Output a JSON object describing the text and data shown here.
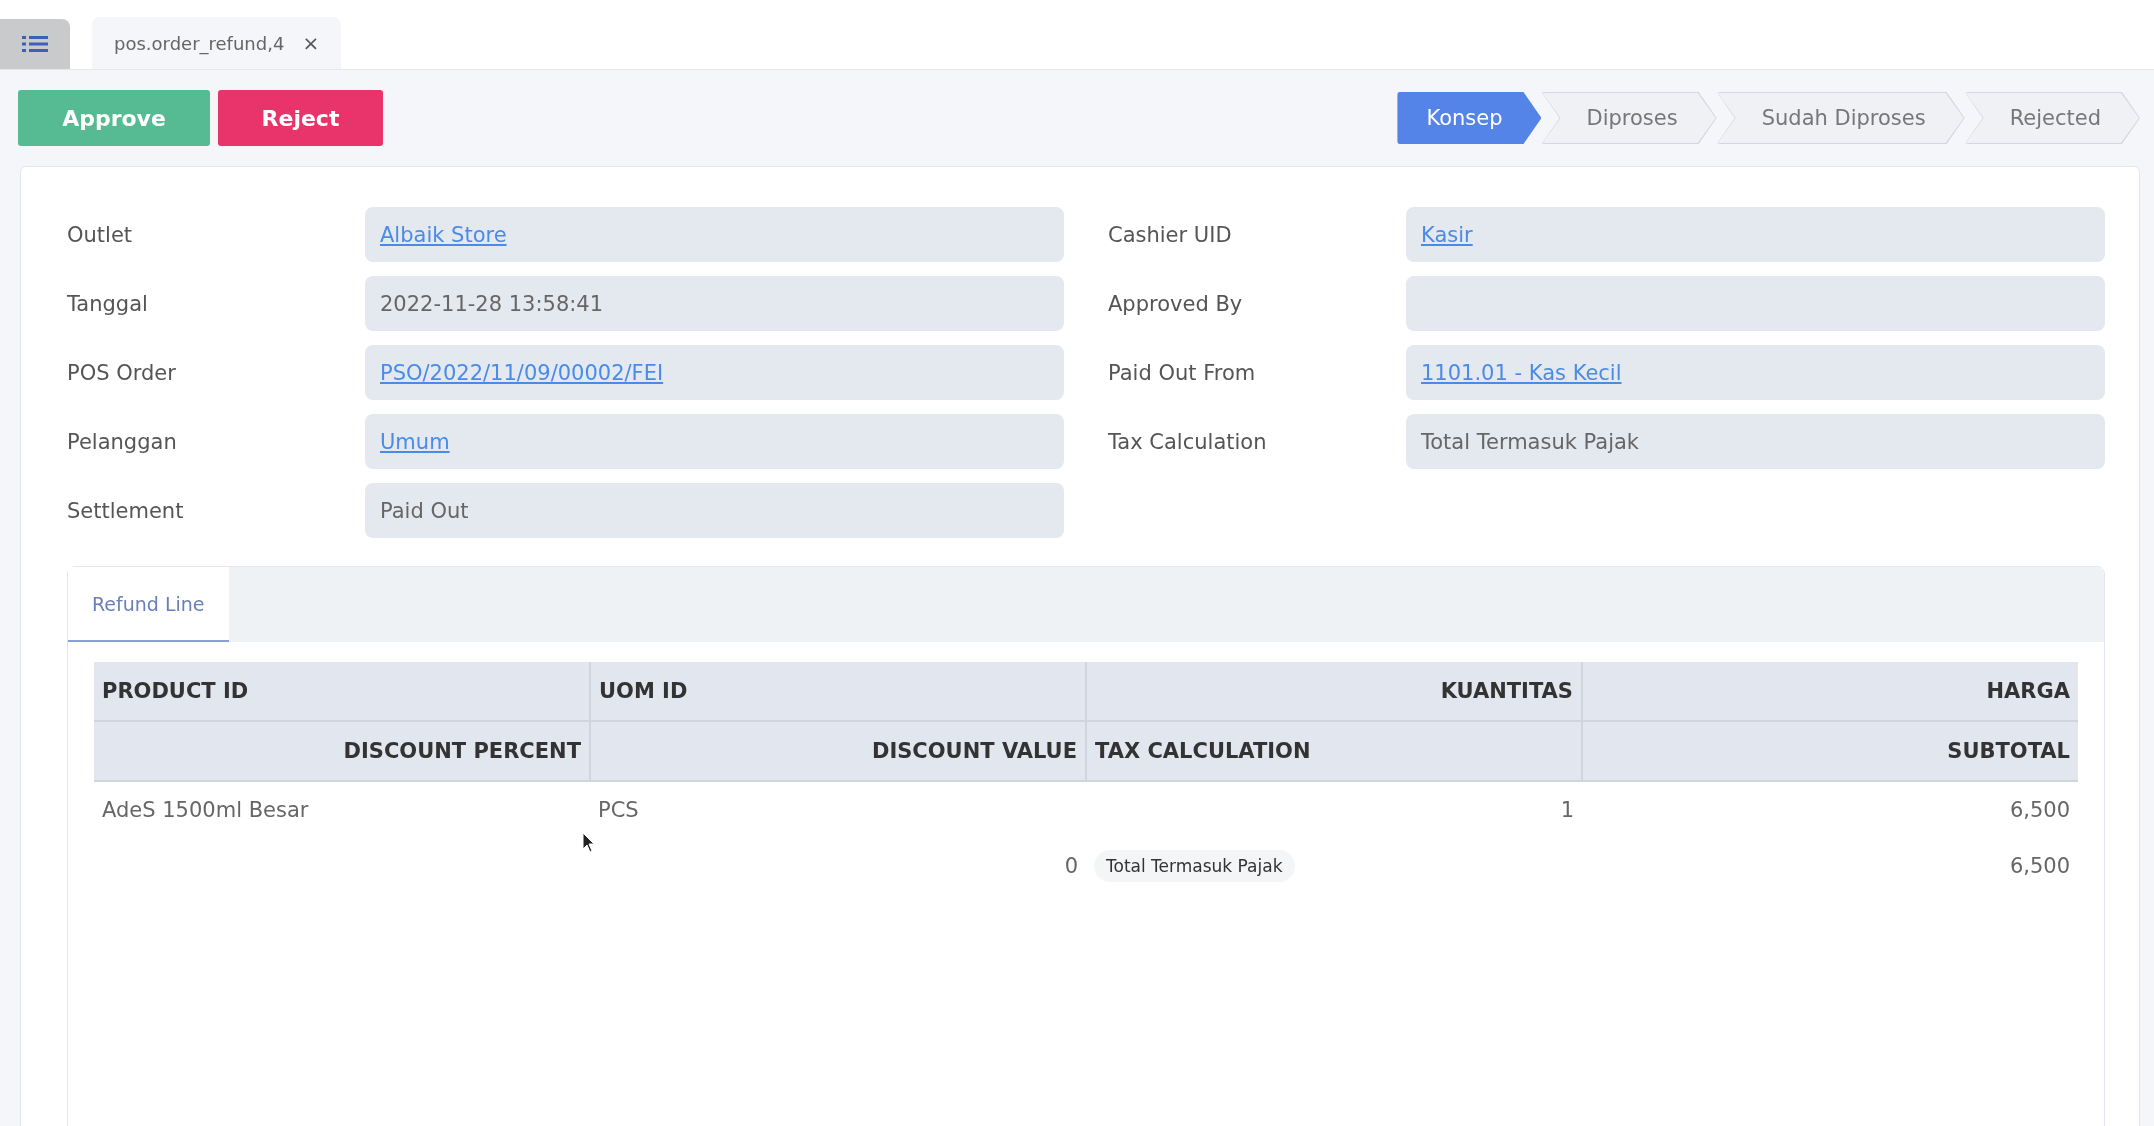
{
  "document_tabs": [
    {
      "label": "pos.order_refund,4",
      "close": "×"
    }
  ],
  "actions": [
    {
      "label": "Approve",
      "kind": "approve"
    },
    {
      "label": "Reject",
      "kind": "reject"
    }
  ],
  "status_steps": [
    {
      "label": "Konsep",
      "selected": true
    },
    {
      "label": "Diproses",
      "selected": false
    },
    {
      "label": "Sudah Diproses",
      "selected": false
    },
    {
      "label": "Rejected",
      "selected": false
    }
  ],
  "form": {
    "left": [
      {
        "label": "Outlet",
        "value": "Albaik Store",
        "kind": "link"
      },
      {
        "label": "Tanggal",
        "value": "2022-11-28 13:58:41",
        "kind": "text"
      },
      {
        "label": "POS Order",
        "value": "PSO/2022/11/09/00002/FEI",
        "kind": "link"
      },
      {
        "label": "Pelanggan",
        "value": "Umum",
        "kind": "link"
      },
      {
        "label": "Settlement",
        "value": "Paid Out",
        "kind": "text"
      }
    ],
    "right": [
      {
        "label": "Cashier UID",
        "value": "Kasir",
        "kind": "link"
      },
      {
        "label": "Approved By"
      },
      {
        "label": "Paid Out From",
        "value": "1101.01 - Kas Kecil",
        "kind": "link"
      },
      {
        "label": "Tax Calculation",
        "value": "Total Termasuk Pajak",
        "kind": "text"
      }
    ]
  },
  "notebook": {
    "tabs": [
      {
        "label": "Refund Line",
        "selected": true
      }
    ],
    "table": {
      "header_rows": [
        [
          {
            "text": "PRODUCT ID",
            "kind": "text"
          },
          {
            "text": "UOM ID",
            "kind": "text"
          },
          {
            "text": "KUANTITAS",
            "kind": "number"
          },
          {
            "text": "HARGA",
            "kind": "number"
          }
        ],
        [
          {
            "text": "DISCOUNT PERCENT",
            "kind": "number"
          },
          {
            "text": "DISCOUNT VALUE",
            "kind": "number"
          },
          {
            "text": "TAX CALCULATION",
            "kind": "text"
          },
          {
            "text": "SUBTOTAL",
            "kind": "number"
          }
        ]
      ],
      "rows": [
        [
          {
            "text": "AdeS 1500ml Besar",
            "kind": "text"
          },
          {
            "text": "PCS",
            "kind": "text"
          },
          {
            "text": "1",
            "kind": "number"
          },
          {
            "text": "6,500",
            "kind": "number"
          }
        ],
        [
          null,
          {
            "text": "0",
            "kind": "number"
          },
          {
            "text": "Total Termasuk Pajak",
            "kind": "badge"
          },
          {
            "text": "6,500",
            "kind": "number"
          }
        ]
      ]
    }
  }
}
